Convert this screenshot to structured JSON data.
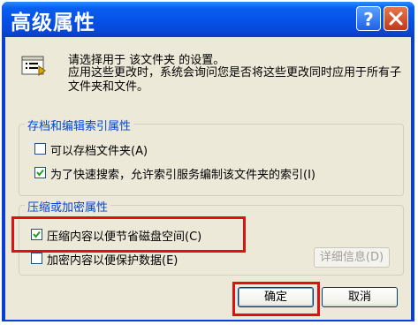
{
  "window": {
    "title": "高级属性"
  },
  "info": {
    "line1": "请选择用于 该文件夹 的设置。",
    "line2": "应用这些更改时，系统会询问您是否将这些更改同时应用于所有子文件夹和文件。"
  },
  "archive_group": {
    "title": "存档和编辑索引属性",
    "options": [
      {
        "label": "可以存档文件夹(A)",
        "checked": false
      },
      {
        "label": "为了快速搜索，允许索引服务编制该文件夹的索引(I)",
        "checked": true
      }
    ]
  },
  "compress_group": {
    "title": "压缩或加密属性",
    "options": [
      {
        "label": "压缩内容以便节省磁盘空间(C)",
        "checked": true
      },
      {
        "label": "加密内容以便保护数据(E)",
        "checked": false
      }
    ],
    "details_label": "详细信息(D)"
  },
  "buttons": {
    "ok": "确定",
    "cancel": "取消"
  },
  "colors": {
    "highlight": "#e01010",
    "title_bar": "#0650e6",
    "group_title": "#0046d5"
  }
}
